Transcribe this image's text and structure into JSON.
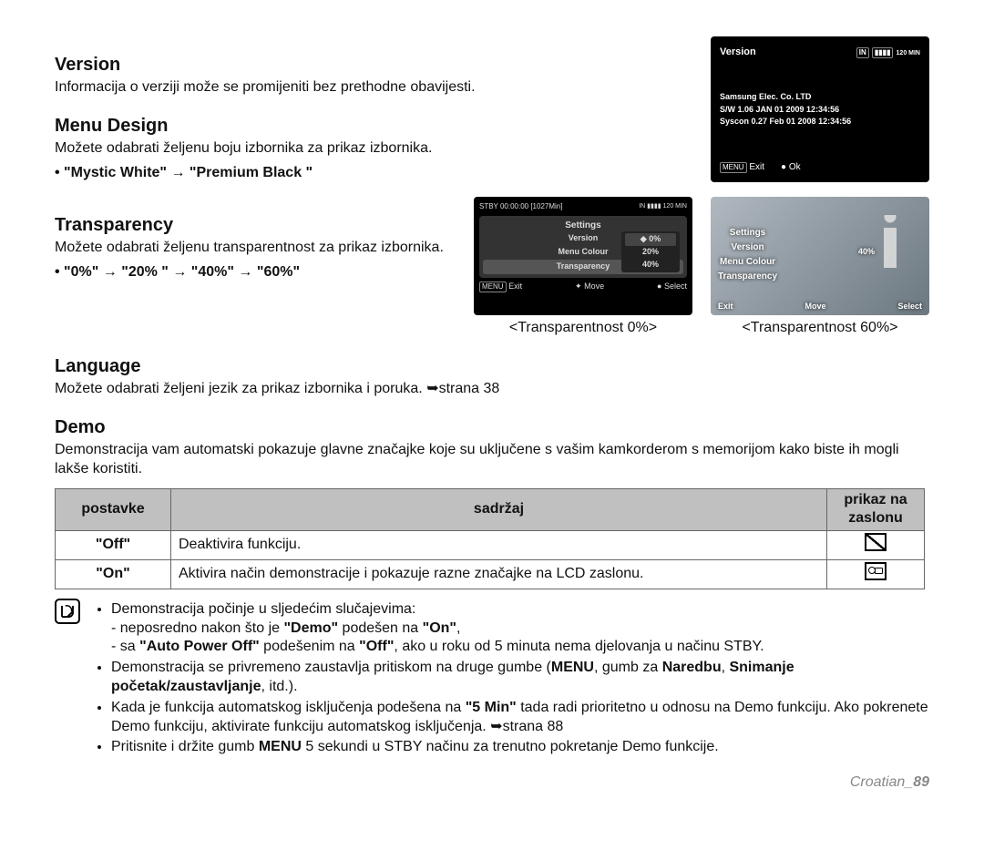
{
  "sections": {
    "version": {
      "title": "Version",
      "body": "Informacija o verziji može se promijeniti bez prethodne obavijesti."
    },
    "menu_design": {
      "title": "Menu Design",
      "body": "Možete odabrati željenu boju izbornika za prikaz izbornika.",
      "options_prefix": "•  ",
      "options": "\"Mystic White\" → \"Premium Black \""
    },
    "transparency": {
      "title": "Transparency",
      "body": "Možete odabrati željenu transparentnost za prikaz izbornika.",
      "options_prefix": "•  ",
      "options": "\"0%\" → \"20% \" → \"40%\" → \"60%\""
    },
    "language": {
      "title": "Language",
      "body": "Možete odabrati željeni jezik za prikaz izbornika i poruka. ➥strana 38"
    },
    "demo": {
      "title": "Demo",
      "body": "Demonstracija vam automatski pokazuje glavne značajke koje su uključene s vašim kamkorderom s memorijom kako biste ih mogli lakše koristiti."
    }
  },
  "version_screen": {
    "title": "Version",
    "badges": {
      "card": "IN",
      "batt": "▮▮▮▮",
      "min": "120 MIN"
    },
    "lines": [
      "Samsung Elec. Co. LTD",
      "S/W 1.06 JAN 01 2009 12:34:56",
      "Syscon 0.27 Feb 01 2008 12:34:56"
    ],
    "foot": {
      "exit_badge": "MENU",
      "exit": "Exit",
      "ok_icon": "●",
      "ok": "Ok"
    }
  },
  "transparency_screens": {
    "left": {
      "status": "STBY 00:00:00 [1027Min]",
      "badges": "IN ▮▮▮▮ 120 MIN",
      "panel_title": "Settings",
      "items": [
        "Version",
        "Menu Colour",
        "Transparency"
      ],
      "highlighted": "Transparency",
      "popup": [
        "0%",
        "20%",
        "40%"
      ],
      "popup_selected": "0%",
      "foot": {
        "exit_badge": "MENU",
        "exit": "Exit",
        "move": "Move",
        "select": "Select"
      },
      "caption": "<Transparentnost 0%>"
    },
    "right": {
      "panel_title": "Settings",
      "items": [
        "Version",
        "Menu Colour",
        "Transparency"
      ],
      "pct": "40%",
      "foot": {
        "exit": "Exit",
        "move": "Move",
        "select": "Select"
      },
      "caption": "<Transparentnost 60%>"
    }
  },
  "demo_table": {
    "headers": [
      "postavke",
      "sadržaj",
      "prikaz na zaslonu"
    ],
    "rows": [
      {
        "setting": "\"Off\"",
        "content": "Deaktivira funkciju.",
        "icon": "off"
      },
      {
        "setting": "\"On\"",
        "content": "Aktivira način demonstracije i pokazuje razne značajke na LCD zaslonu.",
        "icon": "on"
      }
    ]
  },
  "notes": {
    "items_html": [
      "Demonstracija počinje u sljedećim slučajevima:<br>- neposredno nakon što je <span class='b'>\"Demo\"</span> podešen na <span class='b'>\"On\"</span>,<br>- sa <span class='b'>\"Auto Power Off\"</span> podešenim na <span class='b'>\"Off\"</span>, ako u roku od 5 minuta nema djelovanja u načinu STBY.",
      "Demonstracija se privremeno zaustavlja pritiskom na druge gumbe (<span class='b'>MENU</span>, gumb za <span class='b'>Naredbu</span>, <span class='b'>Snimanje početak/zaustavljanje</span>, itd.).",
      "Kada je funkcija automatskog isključenja podešena na <span class='b'>\"5 Min\"</span> tada radi prioritetno u odnosu na Demo funkciju. Ako pokrenete Demo funkciju, aktivirate funkciju automatskog isključenja. ➥strana 88",
      "Pritisnite i držite gumb <span class='b'>MENU</span> 5 sekundi u STBY načinu za trenutno pokretanje Demo funkcije."
    ]
  },
  "footer": {
    "lang": "Croatian_",
    "page": "89"
  }
}
